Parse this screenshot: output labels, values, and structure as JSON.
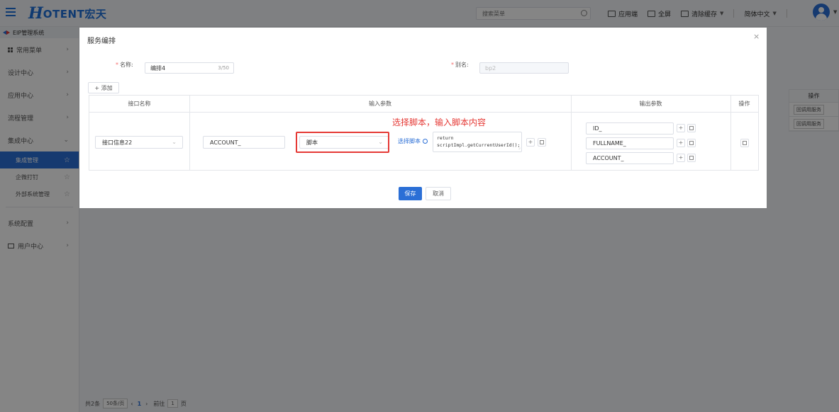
{
  "app": {
    "logo_letter": "H",
    "logo_text": "OTENT宏天",
    "search_placeholder": "搜索菜单",
    "top_actions": [
      {
        "label": "应用端",
        "icon": "monitor-icon"
      },
      {
        "label": "全屏",
        "icon": "fullscreen-icon"
      },
      {
        "label": "清除缓存",
        "icon": "clear-cache-icon"
      }
    ],
    "language": "简体中文"
  },
  "sidebar": {
    "header": "EIP管理系统",
    "items": [
      {
        "label": "常用菜单"
      },
      {
        "label": "设计中心"
      },
      {
        "label": "应用中心"
      },
      {
        "label": "流程管理"
      },
      {
        "label": "集成中心"
      }
    ],
    "sub_items": [
      {
        "label": "集成管理"
      },
      {
        "label": "企微打钉"
      },
      {
        "label": "外部系统管理"
      }
    ],
    "bottom_items": [
      {
        "label": "系统配置"
      },
      {
        "label": "用户中心"
      }
    ]
  },
  "background_table": {
    "header": "操作",
    "rows": [
      "回调用服务",
      "回调用服务"
    ]
  },
  "pager": {
    "total": "共2条",
    "page_size": "50条/页",
    "current_page": "1",
    "goto_label": "前往",
    "goto_value": "1",
    "page_suffix": "页"
  },
  "dialog": {
    "title": "服务编排",
    "name_label": "名称:",
    "name_value": "编排4",
    "name_count": "3/50",
    "alias_label": "别名:",
    "alias_value": "bp2",
    "add_button": "+ 添加",
    "columns": [
      "接口名称",
      "输入参数",
      "输出参数",
      "操作"
    ],
    "row": {
      "interface": "接口信息22",
      "input_param": "ACCOUNT_",
      "input_type": "脚本",
      "select_script_link": "选择脚本",
      "script_content": "return scriptImpl.getCurrentUserId();",
      "outputs": [
        "ID_",
        "FULLNAME_",
        "ACCOUNT_"
      ]
    },
    "annotation": "选择脚本，输入脚本内容",
    "save_button": "保存",
    "cancel_button": "取消"
  }
}
